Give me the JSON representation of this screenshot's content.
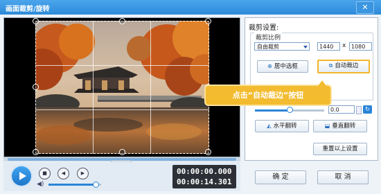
{
  "window": {
    "title": "画面裁剪/旋转",
    "close_icon": "✕"
  },
  "player": {
    "time_current": "00:00:00.000",
    "time_total": "00:00:14.301",
    "volume_level": 0.9
  },
  "crop_panel": {
    "heading": "裁剪设置:",
    "ratio_legend": "裁剪比例",
    "ratio_selected": "自由裁剪",
    "width_value": "1440",
    "times_sign": "x",
    "height_value": "1080",
    "center_button": "居中选框",
    "auto_crop_button": "自动裁边"
  },
  "callout": {
    "text": "点击“自动裁边”按钮"
  },
  "rotate_panel": {
    "angle_value": "0.0",
    "angle_level": 0.5,
    "flip_horizontal_button": "水平翻转",
    "flip_vertical_button": "垂直翻转",
    "reset_button": "重置以上设置"
  },
  "footer": {
    "ok_button": "确  定",
    "cancel_button": "取  消"
  },
  "colors": {
    "titlebar": "#2d8ad9",
    "accent": "#2a84d8",
    "callout": "#f3bb2f"
  }
}
